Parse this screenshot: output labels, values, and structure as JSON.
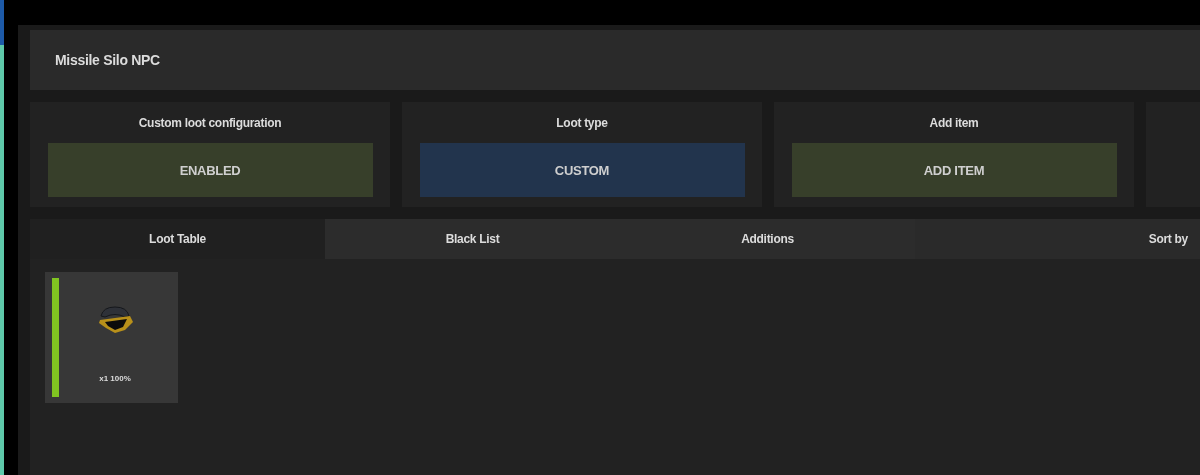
{
  "header": {
    "title": "Missile Silo NPC"
  },
  "settings": [
    {
      "label": "Custom loot configuration",
      "button": "ENABLED",
      "color": "#373f2a"
    },
    {
      "label": "Loot type",
      "button": "CUSTOM",
      "color": "#22344d"
    },
    {
      "label": "Add item",
      "button": "ADD ITEM",
      "color": "#373f2a"
    }
  ],
  "tabs": [
    {
      "label": "Loot Table",
      "selected": true
    },
    {
      "label": "Black List",
      "selected": false
    },
    {
      "label": "Additions",
      "selected": false
    }
  ],
  "sort": {
    "label": "Sort by"
  },
  "items": [
    {
      "caption": "x1 100%",
      "color": "#80c421"
    }
  ]
}
